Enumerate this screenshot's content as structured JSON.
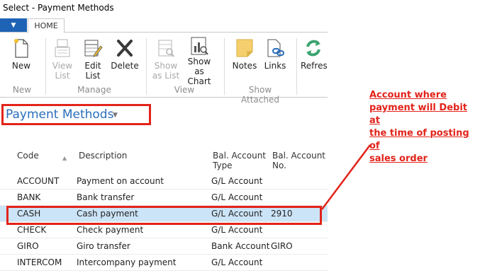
{
  "window": {
    "title": "Select - Payment Methods"
  },
  "tabs": {
    "home_label": "HOME"
  },
  "ribbon": {
    "new": {
      "label": "New"
    },
    "view_list": {
      "label_1": "View",
      "label_2": "List"
    },
    "edit_list": {
      "label_1": "Edit",
      "label_2": "List"
    },
    "delete": {
      "label": "Delete"
    },
    "show_as_list": {
      "label_1": "Show",
      "label_2": "as List"
    },
    "show_as_chart": {
      "label_1": "Show as",
      "label_2": "Chart"
    },
    "notes": {
      "label": "Notes"
    },
    "links": {
      "label": "Links"
    },
    "refresh": {
      "label": "Refresh"
    },
    "groups": {
      "new": "New",
      "manage": "Manage",
      "view": "View",
      "show_attached": "Show Attached"
    }
  },
  "page": {
    "title": "Payment Methods"
  },
  "table": {
    "headers": {
      "code": "Code",
      "description": "Description",
      "bal_type_1": "Bal. Account",
      "bal_type_2": "Type",
      "bal_no_1": "Bal. Account",
      "bal_no_2": "No."
    },
    "rows": [
      {
        "code": "ACCOUNT",
        "description": "Payment on account",
        "bal_type": "G/L Account",
        "bal_no": ""
      },
      {
        "code": "BANK",
        "description": "Bank transfer",
        "bal_type": "G/L Account",
        "bal_no": ""
      },
      {
        "code": "CASH",
        "description": "Cash payment",
        "bal_type": "G/L Account",
        "bal_no": "2910"
      },
      {
        "code": "CHECK",
        "description": "Check payment",
        "bal_type": "G/L Account",
        "bal_no": ""
      },
      {
        "code": "GIRO",
        "description": "Giro transfer",
        "bal_type": "Bank Account",
        "bal_no": "GIRO"
      },
      {
        "code": "INTERCOM",
        "description": "Intercompany payment",
        "bal_type": "G/L Account",
        "bal_no": ""
      }
    ],
    "selected_row": 2
  },
  "annotation": {
    "line_1": "Account where",
    "line_2": "payment will Debit at",
    "line_3": "the time of posting of",
    "line_4": "sales order",
    "color": "#e2231a"
  },
  "colors": {
    "accent": "#2a6ebb",
    "file_button": "#1e63b5",
    "selection": "#cce4f7",
    "highlight": "#e2231a"
  }
}
